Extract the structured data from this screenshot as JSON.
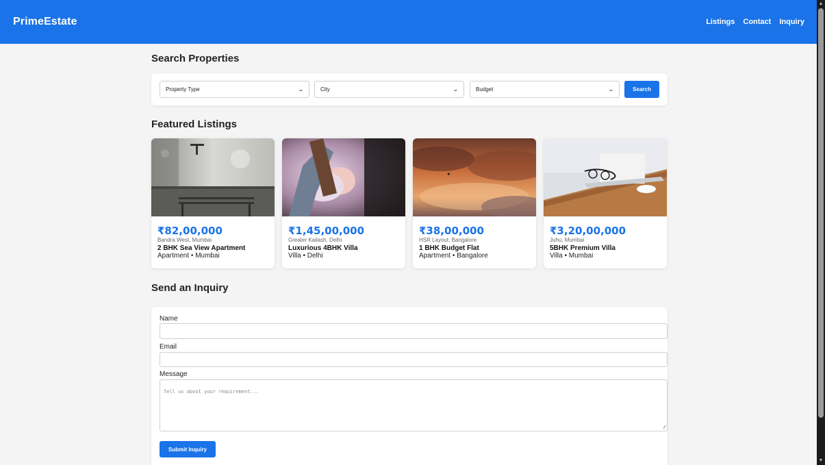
{
  "header": {
    "brand": "PrimeEstate",
    "nav": [
      "Listings",
      "Contact",
      "Inquiry"
    ]
  },
  "search": {
    "title": "Search Properties",
    "property_type": "Property Type",
    "city": "City",
    "budget": "Budget",
    "button": "Search"
  },
  "featured": {
    "title": "Featured Listings",
    "listings": [
      {
        "price": "₹82,00,000",
        "location": "Bandra West, Mumbai",
        "title": "2 BHK Sea View Apartment",
        "meta": "Apartment • Mumbai"
      },
      {
        "price": "₹1,45,00,000",
        "location": "Greater Kailash, Delhi",
        "title": "Luxurious 4BHK Villa",
        "meta": "Villa • Delhi"
      },
      {
        "price": "₹38,00,000",
        "location": "HSR Layout, Bangalore",
        "title": "1 BHK Budget Flat",
        "meta": "Apartment • Bangalore"
      },
      {
        "price": "₹3,20,00,000",
        "location": "Juhu, Mumbai",
        "title": "5BHK Premium Villa",
        "meta": "Villa • Mumbai"
      }
    ]
  },
  "inquiry": {
    "title": "Send an Inquiry",
    "name_label": "Name",
    "name_value": "",
    "email_label": "Email",
    "email_value": "",
    "message_label": "Message",
    "message_placeholder": "Tell us about your requirement...",
    "submit": "Submit Inquiry"
  },
  "colors": {
    "accent": "#1a73e8",
    "background": "#f4f4f4"
  }
}
